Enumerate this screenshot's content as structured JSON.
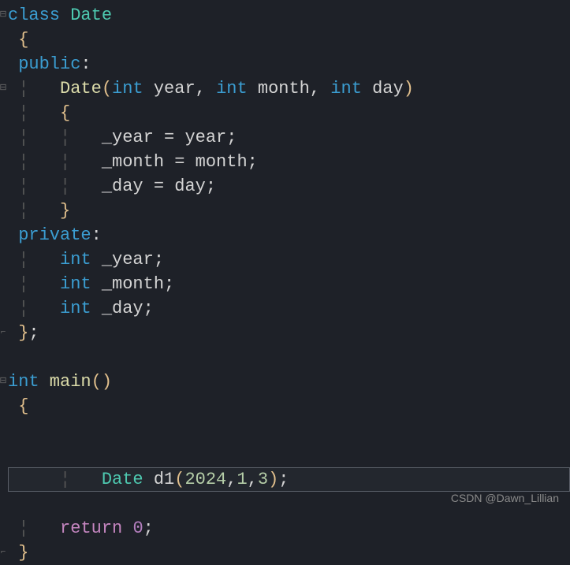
{
  "fold": {
    "collapse": "⊟",
    "end": "⌐"
  },
  "code": {
    "l1_class": "class",
    "l1_name": "Date",
    "l2_brace": "{",
    "l3_public": "public",
    "l3_colon": ":",
    "l4_ctor": "Date",
    "l4_lp": "(",
    "l4_int1": "int",
    "l4_p1": " year",
    "l4_c1": ", ",
    "l4_int2": "int",
    "l4_p2": " month",
    "l4_c2": ", ",
    "l4_int3": "int",
    "l4_p3": " day",
    "l4_rp": ")",
    "l5_brace": "    {",
    "l6_assign": "        _year = year;",
    "l6_lhs": "_year",
    "l6_eq": " = ",
    "l6_rhs": "year",
    "l6_semi": ";",
    "l7_lhs": "_month",
    "l7_eq": " = ",
    "l7_rhs": "month",
    "l7_semi": ";",
    "l8_lhs": "_day",
    "l8_eq": " = ",
    "l8_rhs": "day",
    "l8_semi": ";",
    "l9_brace": "    }",
    "l10_private": "private",
    "l10_colon": ":",
    "l11_int": "int",
    "l11_name": " _year",
    "l11_semi": ";",
    "l12_int": "int",
    "l12_name": " _month",
    "l12_semi": ";",
    "l13_int": "int",
    "l13_name": " _day",
    "l13_semi": ";",
    "l14_brace": "}",
    "l14_semi": ";",
    "l16_int": "int",
    "l16_main": " main",
    "l16_parens": "()",
    "l17_brace": "{",
    "l18_type": "Date",
    "l18_var": " d1",
    "l18_lp": "(",
    "l18_a1": "2024",
    "l18_c1": ",",
    "l18_a2": "1",
    "l18_c2": ",",
    "l18_a3": "3",
    "l18_rp": ")",
    "l18_semi": ";",
    "l19_ret": "return",
    "l19_sp": " ",
    "l19_zero": "0",
    "l19_semi": ";",
    "l20_brace": "}"
  },
  "watermark": "CSDN @Dawn_Lillian"
}
